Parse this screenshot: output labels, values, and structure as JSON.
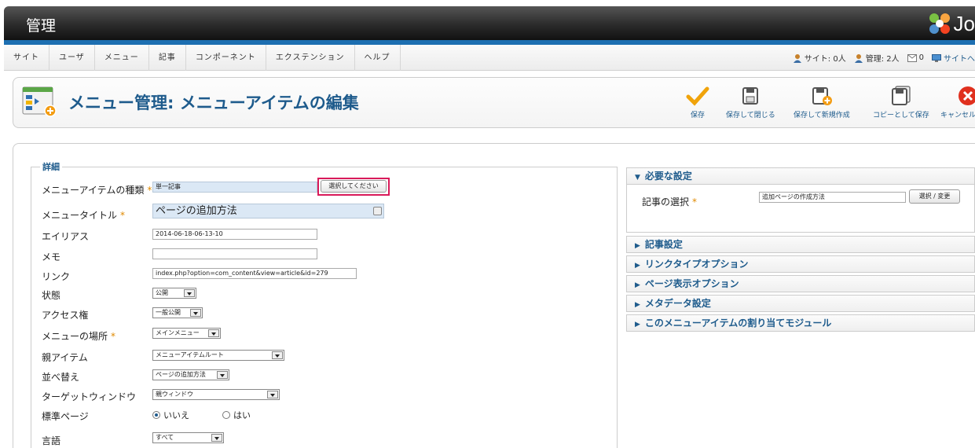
{
  "header": {
    "title": "管理",
    "logo_text": "Jo"
  },
  "menu": [
    "サイト",
    "ユーザ",
    "メニュー",
    "記事",
    "コンポーネント",
    "エクステンション",
    "ヘルプ"
  ],
  "status": {
    "site": "サイト: 0人",
    "admin": "管理: 2人",
    "messages": "0",
    "site_link": "サイトへ"
  },
  "page": {
    "title": "メニュー管理: メニューアイテムの編集"
  },
  "toolbar": {
    "save": "保存",
    "save_close": "保存して閉じる",
    "save_new": "保存して新規作成",
    "save_copy": "コピーとして保存",
    "cancel": "キャンセル"
  },
  "details": {
    "legend": "詳細",
    "type_label": "メニューアイテムの種類",
    "type_value": "単一記事",
    "type_button": "選択してください",
    "title_label": "メニュータイトル",
    "title_value": "ページの追加方法",
    "alias_label": "エイリアス",
    "alias_value": "2014-06-18-06-13-10",
    "note_label": "メモ",
    "note_value": "",
    "link_label": "リンク",
    "link_value": "index.php?option=com_content&view=article&id=279",
    "status_label": "状態",
    "status_value": "公開",
    "access_label": "アクセス権",
    "access_value": "一般公開",
    "menu_location_label": "メニューの場所",
    "menu_location_value": "メインメニュー",
    "parent_label": "親アイテム",
    "parent_value": "メニューアイテムルート",
    "order_label": "並べ替え",
    "order_value": "ページの追加方法",
    "target_label": "ターゲットウィンドウ",
    "target_value": "親ウィンドウ",
    "default_label": "標準ページ",
    "default_no": "いいえ",
    "default_yes": "はい",
    "language_label": "言語",
    "language_value": "すべて",
    "required_mark": "*"
  },
  "right": {
    "required_settings": "必要な設定",
    "article_select_label": "記事の選択",
    "article_select_value": "追加ページの作成方法",
    "article_select_button": "選択 / 変更",
    "article_options": "記事設定",
    "link_type_options": "リンクタイプオプション",
    "page_display_options": "ページ表示オプション",
    "metadata_options": "メタデータ設定",
    "module_assignment": "このメニューアイテムの割り当てモジュール"
  },
  "colors": {
    "accent": "#1e5b8c",
    "header_blue_bar": "#1d6fb1",
    "highlight": "#d91a5a",
    "required": "#e08a00"
  }
}
